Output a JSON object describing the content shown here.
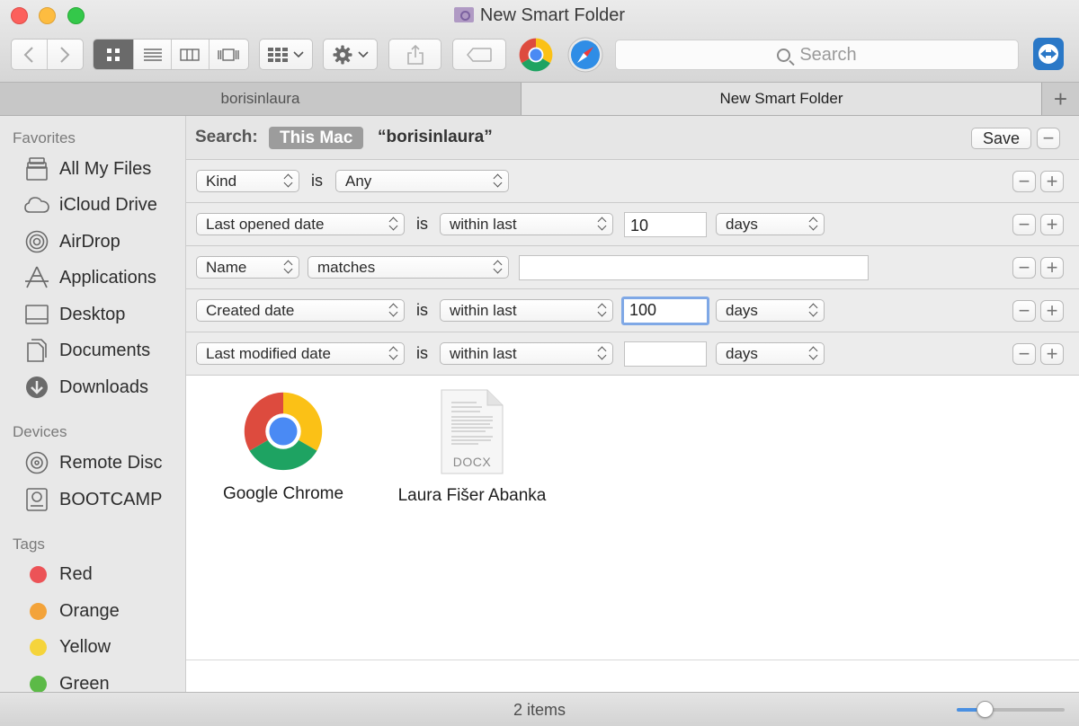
{
  "window": {
    "title": "New Smart Folder"
  },
  "toolbar": {
    "search_placeholder": "Search",
    "view_options": [
      "icon-view",
      "list-view",
      "column-view",
      "cover-flow-view"
    ],
    "active_view": "icon-view"
  },
  "tabs": [
    {
      "label": "borisinlaura",
      "active": false
    },
    {
      "label": "New Smart Folder",
      "active": true
    }
  ],
  "sidebar": {
    "favorites_header": "Favorites",
    "favorites": [
      {
        "label": "All My Files",
        "icon": "all-files-icon"
      },
      {
        "label": "iCloud Drive",
        "icon": "cloud-icon"
      },
      {
        "label": "AirDrop",
        "icon": "airdrop-icon"
      },
      {
        "label": "Applications",
        "icon": "applications-icon"
      },
      {
        "label": "Desktop",
        "icon": "desktop-icon"
      },
      {
        "label": "Documents",
        "icon": "documents-icon"
      },
      {
        "label": "Downloads",
        "icon": "downloads-icon"
      }
    ],
    "devices_header": "Devices",
    "devices": [
      {
        "label": "Remote Disc",
        "icon": "disc-icon"
      },
      {
        "label": "BOOTCAMP",
        "icon": "drive-icon"
      }
    ],
    "tags_header": "Tags",
    "tags": [
      {
        "label": "Red",
        "color": "#ec5357"
      },
      {
        "label": "Orange",
        "color": "#f3a33a"
      },
      {
        "label": "Yellow",
        "color": "#f5d43b"
      },
      {
        "label": "Green",
        "color": "#5cba47"
      }
    ]
  },
  "search": {
    "label": "Search:",
    "scope": "This Mac",
    "term": "“borisinlaura”",
    "save_label": "Save"
  },
  "rules": {
    "r1": {
      "attribute": "Kind",
      "operator": "is",
      "value": "Any"
    },
    "r2": {
      "attribute": "Last opened date",
      "operator": "is",
      "condition": "within last",
      "amount": "10",
      "unit": "days"
    },
    "r3": {
      "attribute": "Name",
      "condition": "matches",
      "amount": ""
    },
    "r4": {
      "attribute": "Created date",
      "operator": "is",
      "condition": "within last",
      "amount": "100",
      "unit": "days"
    },
    "r5": {
      "attribute": "Last modified date",
      "operator": "is",
      "condition": "within last",
      "amount": "",
      "unit": "days"
    }
  },
  "results": {
    "files": [
      {
        "name": "Google Chrome",
        "icon": "chrome-app-icon"
      },
      {
        "name": "Laura Fišer Abanka",
        "icon": "docx-file-icon",
        "badge": "DOCX"
      }
    ]
  },
  "status": {
    "item_count": "2 items",
    "icon_size_fraction": 0.27
  }
}
